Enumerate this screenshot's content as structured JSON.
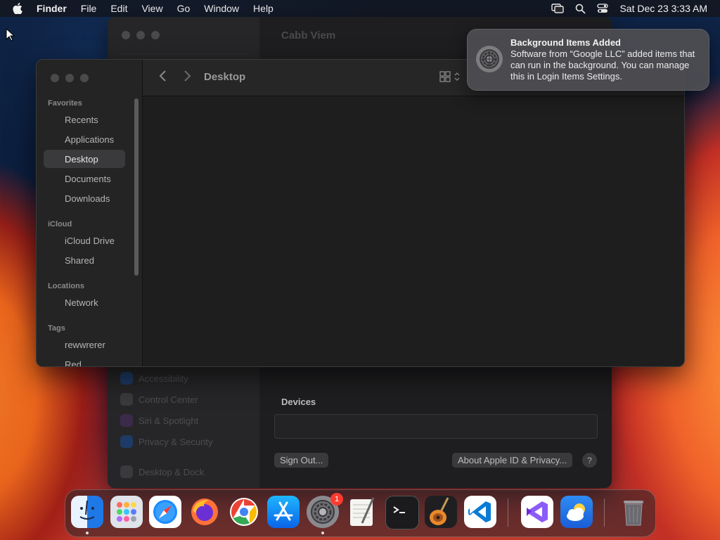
{
  "menubar": {
    "app": "Finder",
    "menus": [
      "File",
      "Edit",
      "View",
      "Go",
      "Window",
      "Help"
    ],
    "clock": "Sat Dec 23  3:33 AM",
    "status_icons": [
      "screen-mirroring-icon",
      "search-icon",
      "control-center-icon"
    ]
  },
  "settings_window": {
    "title": "Cabb Viem",
    "sidebar": [
      {
        "label": "Accessibility",
        "icon": "accessibility-icon"
      },
      {
        "label": "Control Center",
        "icon": "control-center-icon"
      },
      {
        "label": "Siri & Spotlight",
        "icon": "siri-icon"
      },
      {
        "label": "Privacy & Security",
        "icon": "privacy-icon"
      },
      {
        "label": "Desktop & Dock",
        "icon": "desktop-dock-icon"
      }
    ],
    "devices_label": "Devices",
    "sign_out": "Sign Out...",
    "about_privacy": "About Apple ID & Privacy...",
    "help": "?"
  },
  "finder": {
    "title": "Desktop",
    "sections": {
      "favorites": "Favorites",
      "icloud": "iCloud",
      "locations": "Locations",
      "tags": "Tags"
    },
    "favorites": [
      "Recents",
      "Applications",
      "Desktop",
      "Documents",
      "Downloads"
    ],
    "icloud": [
      "iCloud Drive",
      "Shared"
    ],
    "locations": [
      "Network"
    ],
    "tags": [
      "rewwrerer",
      "Red"
    ],
    "selected": "Desktop"
  },
  "notification": {
    "title": "Background Items Added",
    "body": "Software from “Google LLC” added items that can run in the background. You can manage this in Login Items Settings."
  },
  "dock": {
    "apps": [
      "Finder",
      "Launchpad",
      "Safari",
      "Firefox",
      "Chrome",
      "App Store",
      "System Settings",
      "TextEdit",
      "Terminal",
      "GarageBand",
      "Visual Studio Code",
      "Visual Studio",
      "Weather",
      "Trash"
    ],
    "settings_badge": "1"
  }
}
